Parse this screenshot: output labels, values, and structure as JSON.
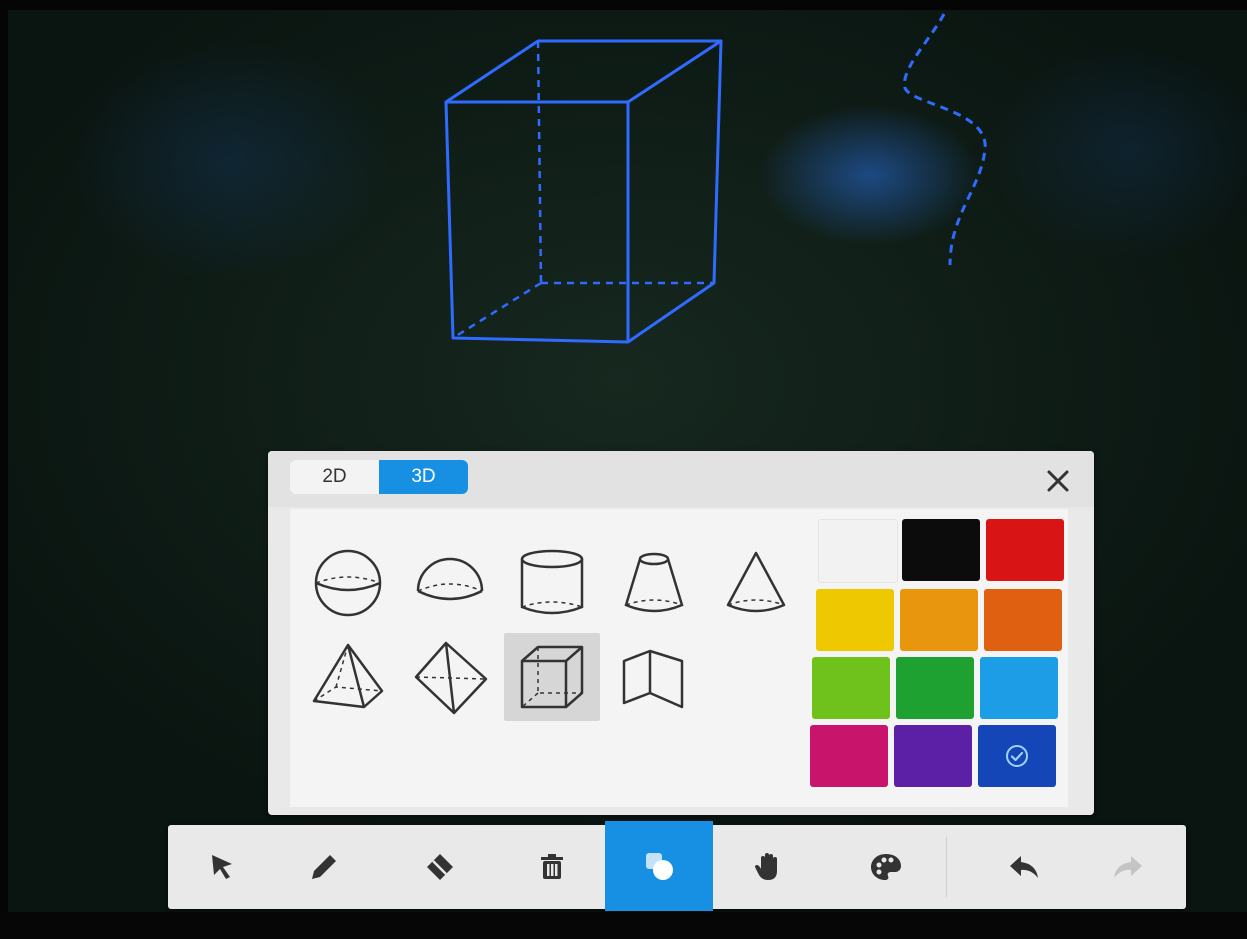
{
  "canvas": {
    "stroke_color": "#2f6bff"
  },
  "shape_panel": {
    "tabs": [
      {
        "label": "2D",
        "active": false
      },
      {
        "label": "3D",
        "active": true
      }
    ],
    "close_icon": "close-icon",
    "shapes": [
      {
        "name": "sphere",
        "icon": "sphere-icon",
        "selected": false
      },
      {
        "name": "hemisphere",
        "icon": "hemisphere-icon",
        "selected": false
      },
      {
        "name": "cylinder",
        "icon": "cylinder-icon",
        "selected": false
      },
      {
        "name": "frustum",
        "icon": "frustum-icon",
        "selected": false
      },
      {
        "name": "cone",
        "icon": "cone-icon",
        "selected": false
      },
      {
        "name": "pyramid",
        "icon": "pyramid-icon",
        "selected": false
      },
      {
        "name": "octahedron",
        "icon": "octahedron-icon",
        "selected": false
      },
      {
        "name": "cube",
        "icon": "cube-icon",
        "selected": true
      },
      {
        "name": "open-book",
        "icon": "open-book-icon",
        "selected": false
      }
    ],
    "colors": [
      {
        "hex": "#f2f2f2",
        "selected": false
      },
      {
        "hex": "#0c0c0c",
        "selected": false
      },
      {
        "hex": "#d81414",
        "selected": false
      },
      {
        "hex": "#eec800",
        "selected": false
      },
      {
        "hex": "#e8960e",
        "selected": false
      },
      {
        "hex": "#e06012",
        "selected": false
      },
      {
        "hex": "#6fc21c",
        "selected": false
      },
      {
        "hex": "#1fa132",
        "selected": false
      },
      {
        "hex": "#1c9de6",
        "selected": false
      },
      {
        "hex": "#c9146c",
        "selected": false
      },
      {
        "hex": "#5c20a6",
        "selected": false
      },
      {
        "hex": "#1446b8",
        "selected": true
      }
    ]
  },
  "toolbar": {
    "tools": [
      {
        "name": "select",
        "icon": "cursor-arrow-icon",
        "active": false
      },
      {
        "name": "pen",
        "icon": "pencil-icon",
        "active": false
      },
      {
        "name": "eraser",
        "icon": "eraser-icon",
        "active": false
      },
      {
        "name": "clear",
        "icon": "trash-icon",
        "active": false
      },
      {
        "name": "shapes",
        "icon": "shapes-icon",
        "active": true
      },
      {
        "name": "pan",
        "icon": "hand-icon",
        "active": false
      },
      {
        "name": "color",
        "icon": "palette-icon",
        "active": false
      },
      {
        "name": "undo",
        "icon": "undo-icon",
        "active": false
      },
      {
        "name": "redo",
        "icon": "redo-icon",
        "active": false,
        "disabled": true
      }
    ]
  }
}
